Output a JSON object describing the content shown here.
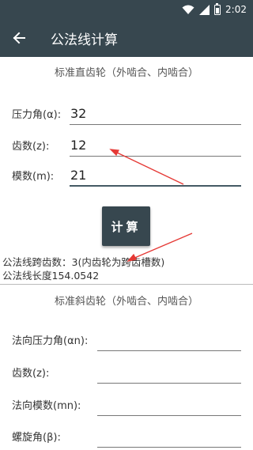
{
  "status_bar": {
    "time": "2:02"
  },
  "app_bar": {
    "title": "公法线计算"
  },
  "spur": {
    "heading": "标准直齿轮（外啮合、内啮合）",
    "fields": [
      {
        "label": "压力角(α):",
        "value": "32"
      },
      {
        "label": "齿数(z):",
        "value": "12"
      },
      {
        "label": "模数(m):",
        "value": "21"
      }
    ],
    "button_label": "计算",
    "result_span": "公法线跨齿数：3(内齿轮为跨齿槽数)",
    "result_length": "公法线长度154.0542"
  },
  "helical": {
    "heading": "标准斜齿轮（外啮合、内啮合）",
    "fields": [
      {
        "label": "法向压力角(αn):",
        "value": ""
      },
      {
        "label": "齿数(z):",
        "value": ""
      },
      {
        "label": "法向模数(mn):",
        "value": ""
      },
      {
        "label": "螺旋角(β):",
        "value": ""
      }
    ]
  },
  "colors": {
    "primary": "#37474f",
    "annotation": "#e53935"
  },
  "icons": [
    "wifi-icon",
    "signal-icon",
    "battery-icon",
    "back-arrow-icon"
  ]
}
